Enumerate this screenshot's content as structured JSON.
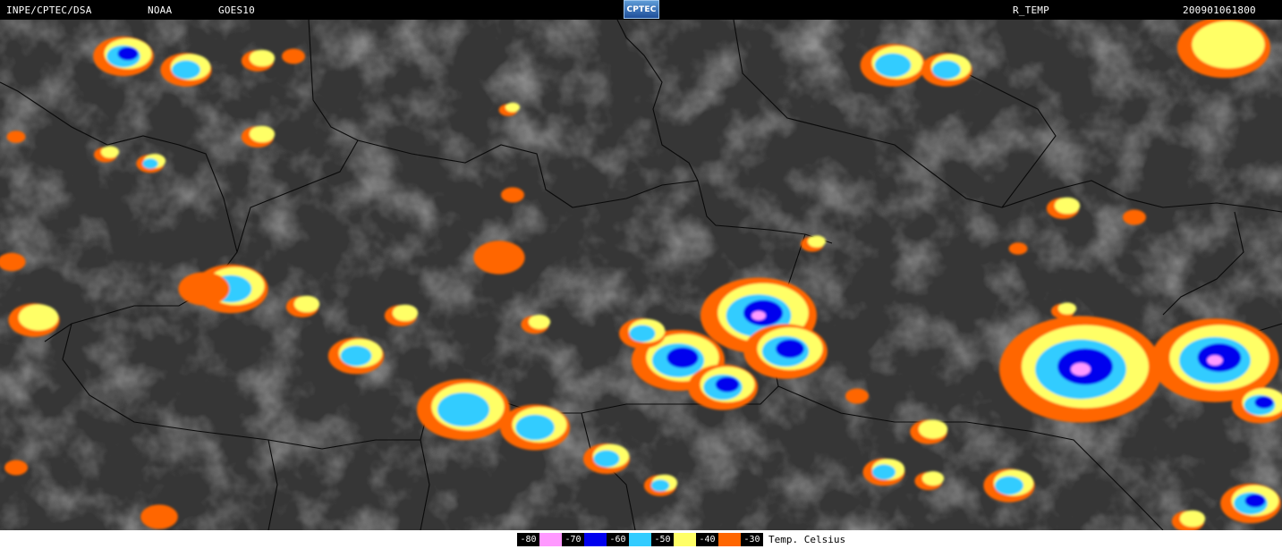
{
  "header": {
    "agency": "INPE/CPTEC/DSA",
    "provider": "NOAA",
    "satellite": "GOES10",
    "logo_text": "CPTEC",
    "product": "R_TEMP",
    "timestamp": "200901061800"
  },
  "legend": {
    "entries": [
      {
        "label": "-80",
        "color": "#ff99ff"
      },
      {
        "label": "-70",
        "color": "#0000ee"
      },
      {
        "label": "-60",
        "color": "#33ccff"
      },
      {
        "label": "-50",
        "color": "#ffff66"
      },
      {
        "label": "-40",
        "color": "#ff6600"
      },
      {
        "label": "-30",
        "color": "#ffffff"
      }
    ],
    "unit": "Temp. Celsius"
  },
  "map": {
    "icons": [
      "satellite-infrared-image",
      "political-borders"
    ]
  }
}
